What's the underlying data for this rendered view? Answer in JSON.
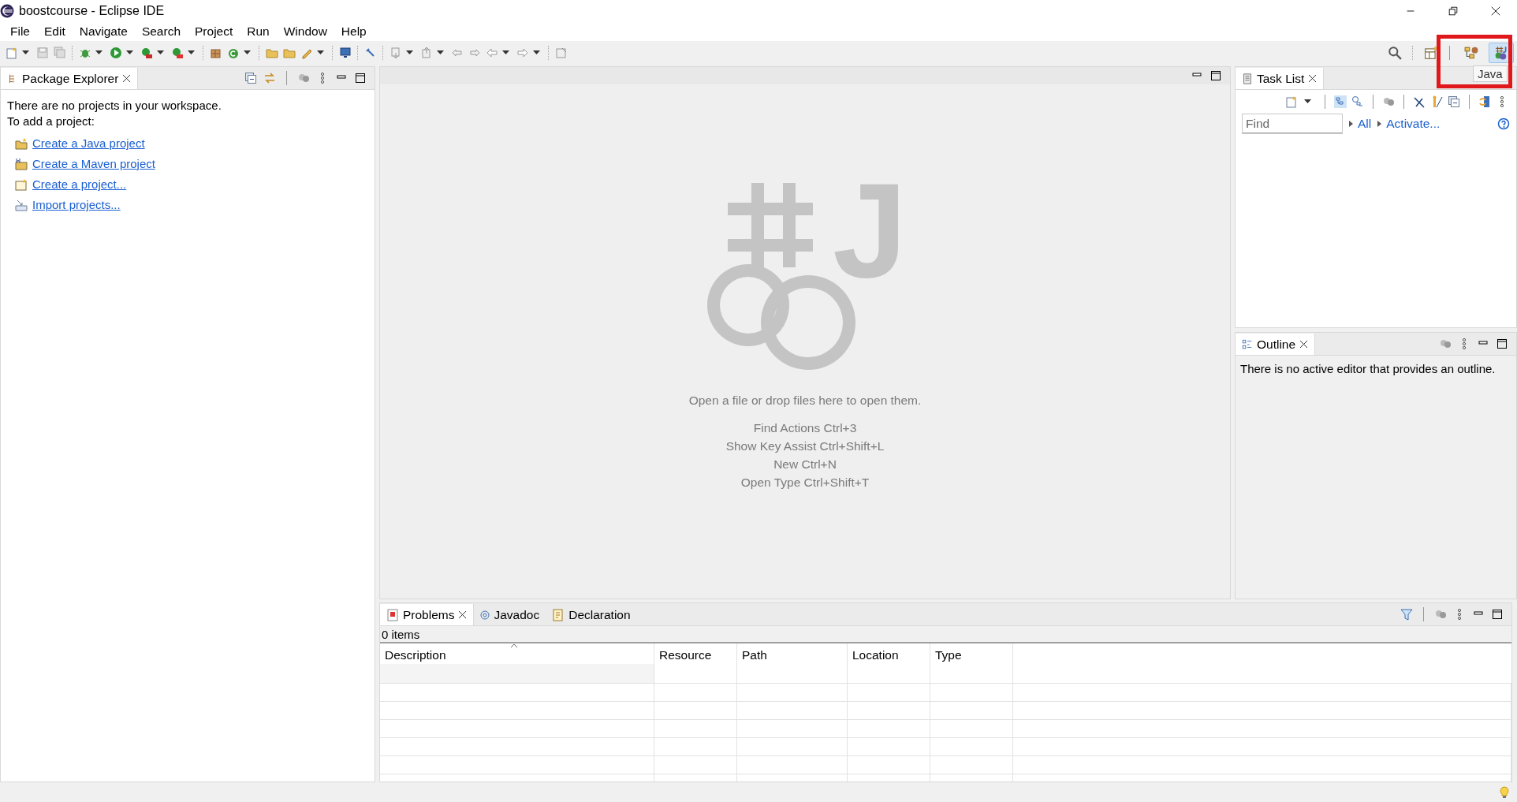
{
  "window": {
    "title": "boostcourse - Eclipse IDE"
  },
  "menu": [
    {
      "label": "File"
    },
    {
      "label": "Edit"
    },
    {
      "label": "Navigate"
    },
    {
      "label": "Search"
    },
    {
      "label": "Project"
    },
    {
      "label": "Run"
    },
    {
      "label": "Window"
    },
    {
      "label": "Help"
    }
  ],
  "perspectives": [
    {
      "kind": "hierarchy",
      "selected": false
    },
    {
      "kind": "java",
      "selected": true
    }
  ],
  "perspective_tooltip": "Java",
  "package_explorer": {
    "tab": {
      "label": "Package Explorer",
      "selected": true
    },
    "message": [
      "There are no projects in your workspace.",
      "To add a project:"
    ],
    "links": [
      {
        "label": "Create a Java project",
        "kind": "java"
      },
      {
        "label": "Create a Maven project",
        "kind": "maven"
      },
      {
        "label": "Create a project...",
        "kind": "project"
      },
      {
        "label": "Import projects...",
        "kind": "import"
      }
    ]
  },
  "editor": {
    "logo_letter": "J",
    "hints": [
      "Open a file or drop files here to open them.",
      "Find Actions Ctrl+3",
      "Show Key Assist Ctrl+Shift+L",
      "New Ctrl+N",
      "Open Type Ctrl+Shift+T"
    ]
  },
  "task_list": {
    "tab": {
      "label": "Task List",
      "selected": true
    },
    "find": {
      "placeholder": "Find"
    },
    "filters": [
      "All",
      "Activate..."
    ]
  },
  "outline": {
    "tab": {
      "label": "Outline",
      "selected": true
    },
    "message": "There is no active editor that provides an outline."
  },
  "problems": {
    "tabs": [
      {
        "label": "Problems",
        "kind": "problems",
        "selected": true
      },
      {
        "label": "Javadoc",
        "kind": "javadoc",
        "selected": false
      },
      {
        "label": "Declaration",
        "kind": "declaration",
        "selected": false
      }
    ],
    "count": "0 items",
    "columns": [
      "Description",
      "Resource",
      "Path",
      "Location",
      "Type"
    ]
  }
}
